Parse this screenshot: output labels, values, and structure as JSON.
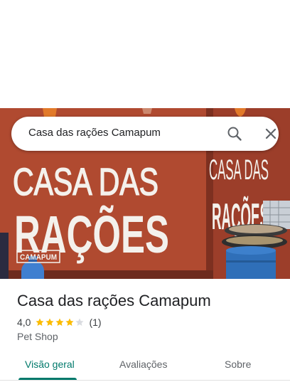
{
  "search": {
    "query": "Casa das rações Camapum",
    "search_icon": "search-icon",
    "close_icon": "close-icon"
  },
  "hero": {
    "wall_text_line1": "CASA DAS",
    "wall_text_line2": "RAÇÕES",
    "wall_badge": "CAMAPUM",
    "side_text_line1": "CASA DAS",
    "side_text_line2": "RAÇÕES",
    "colors": {
      "wall": "#a8432c",
      "paint": "#f4f1ec",
      "barrel": "#2f6fb8"
    }
  },
  "place": {
    "name": "Casa das rações Camapum",
    "rating": "4,0",
    "stars_filled": 4,
    "stars_total": 5,
    "review_count": "(1)",
    "category": "Pet Shop",
    "star_color": "#fbbc04",
    "star_empty_color": "#dadce0"
  },
  "tabs": [
    {
      "label": "Visão geral",
      "active": true
    },
    {
      "label": "Avaliações",
      "active": false
    },
    {
      "label": "Sobre",
      "active": false
    }
  ],
  "accent_color": "#00796b"
}
